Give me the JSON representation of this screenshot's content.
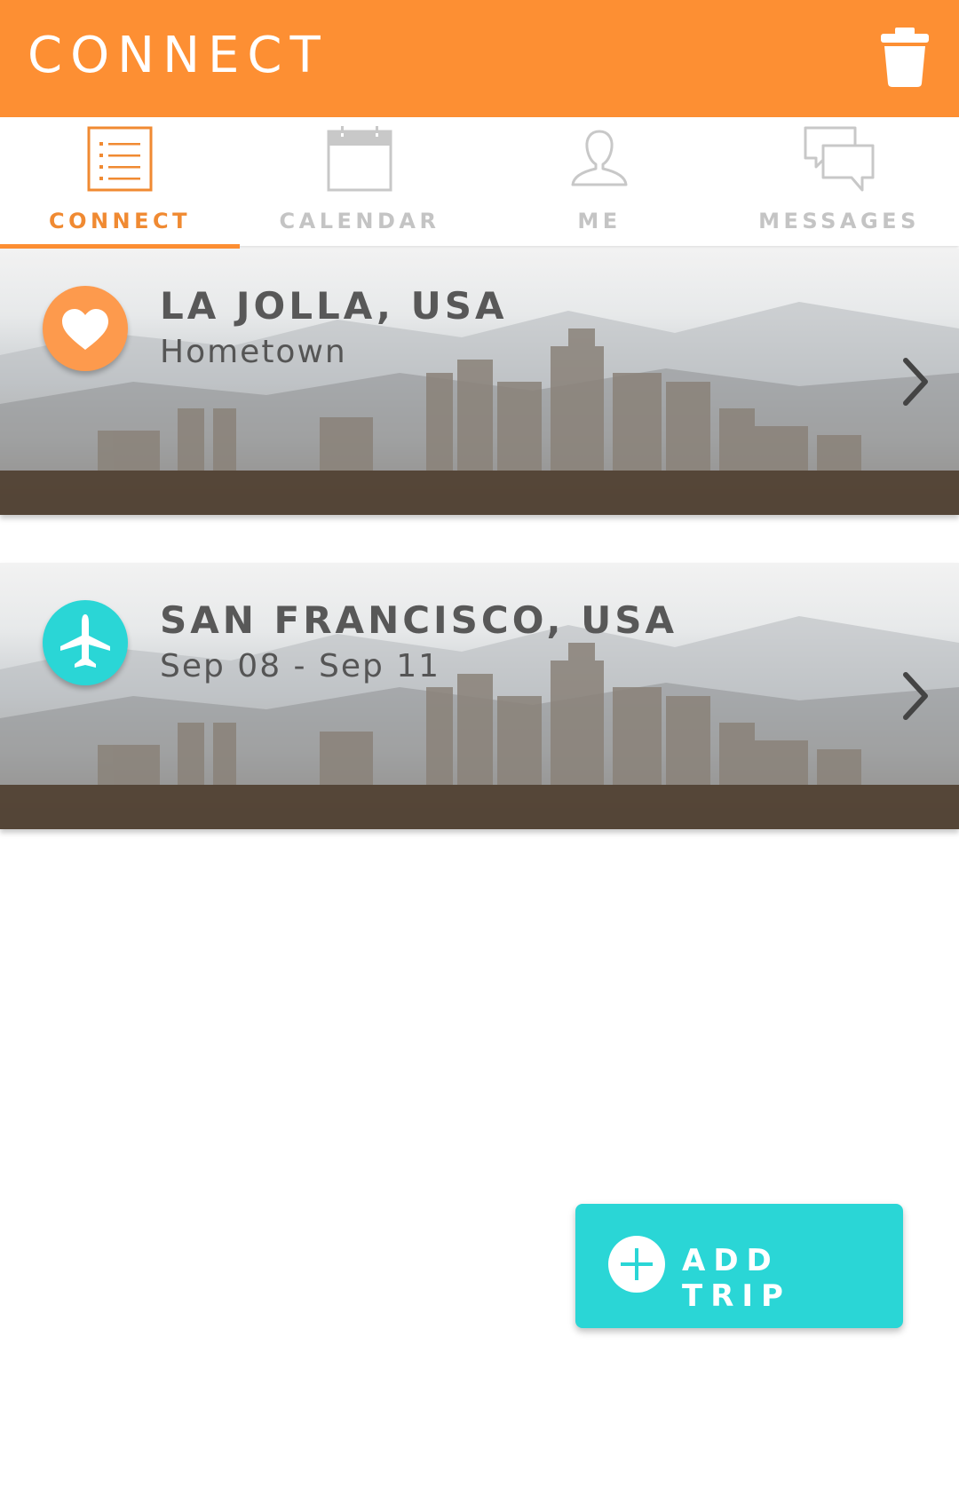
{
  "header": {
    "title": "CONNECT"
  },
  "tabs": [
    {
      "label": "CONNECT",
      "icon": "list-icon",
      "active": true
    },
    {
      "label": "CALENDAR",
      "icon": "calendar-icon",
      "active": false
    },
    {
      "label": "ME",
      "icon": "person-icon",
      "active": false
    },
    {
      "label": "MESSAGES",
      "icon": "messages-icon",
      "active": false
    }
  ],
  "trips": [
    {
      "title": "LA JOLLA, USA",
      "subtitle": "Hometown",
      "icon": "heart-icon",
      "badge_color": "#fd9a4d"
    },
    {
      "title": "SAN FRANCISCO, USA",
      "subtitle": "Sep 08 - Sep 11",
      "icon": "airplane-icon",
      "badge_color": "#2ad6d6"
    }
  ],
  "add_trip": {
    "label": "ADD TRIP"
  },
  "colors": {
    "accent": "#fd8f33",
    "teal": "#2ad6d6",
    "inactive": "#c4c4c4"
  }
}
